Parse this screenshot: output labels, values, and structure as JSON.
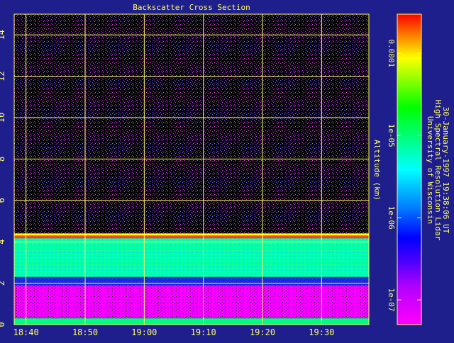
{
  "chart_data": {
    "type": "heatmap",
    "title": "Backscatter Cross Section",
    "x_ticks": [
      "18:40",
      "18:50",
      "19:00",
      "19:10",
      "19:20",
      "19:30"
    ],
    "y_ticks": [
      "0",
      "2",
      "4",
      "6",
      "8",
      "10",
      "12",
      "14"
    ],
    "ylabel": "Altitude (km)",
    "xlim": [
      "18:38",
      "19:38"
    ],
    "ylim": [
      0,
      15
    ],
    "grid": true,
    "colorbar": {
      "scale": "log",
      "range": [
        5e-08,
        0.0003
      ],
      "ticks": [
        "1e-07",
        "1e-06",
        "1e-05",
        "0.0001"
      ]
    },
    "side_text": [
      "University of Wisconsin",
      "High Spectral Resolution Lidar",
      "30-January-1997 19:38:06 UT"
    ],
    "features": {
      "cloud_top_km": 4.2,
      "aerosol_layer_km": [
        0.3,
        1.9
      ]
    },
    "colors": {
      "background": "#1e1e8c",
      "axis": "#ffff66",
      "plot_bg": "#000000"
    }
  }
}
